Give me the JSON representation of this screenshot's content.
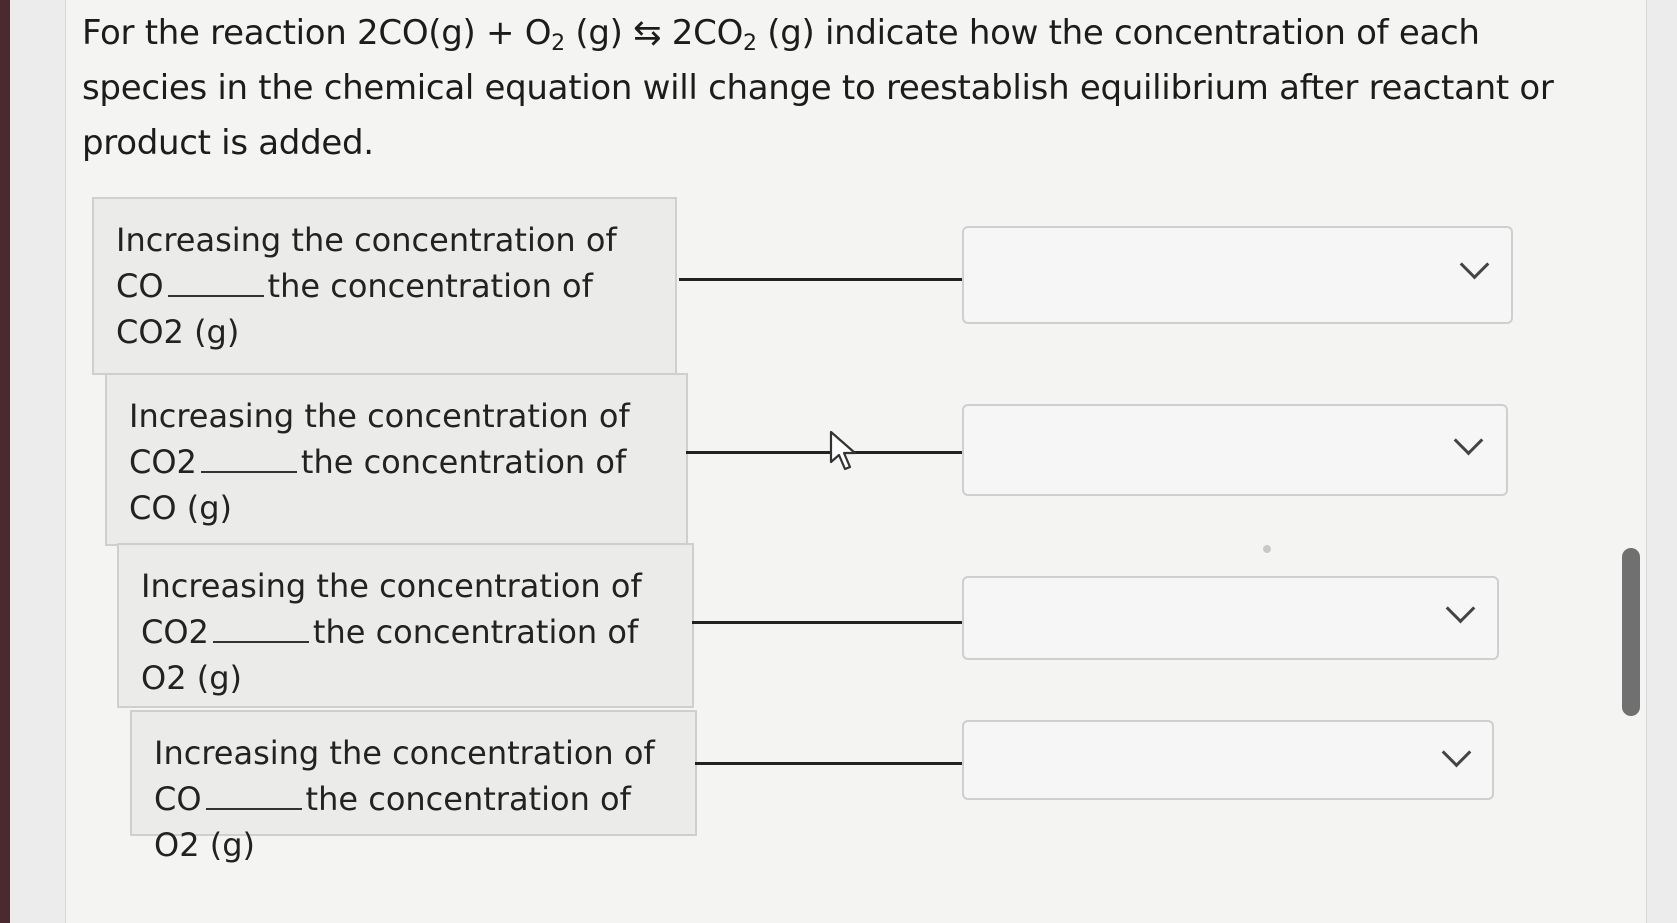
{
  "question": {
    "part1": "For the reaction 2CO(g) + O",
    "sub1": "2",
    "part2": " (g) ⇆ 2CO",
    "sub2": "2",
    "part3": " (g) indicate how the concentration of each species in the chemical equation will change to reestablish equilibrium after reactant or product is added."
  },
  "items": [
    {
      "pre": "Increasing the concentration of CO",
      "post": "the concentration of CO2 (g)",
      "selected": ""
    },
    {
      "pre": "Increasing the concentration of CO2",
      "post": "the concentration of CO (g)",
      "selected": ""
    },
    {
      "pre": "Increasing the concentration of CO2",
      "post": "the concentration of O2 (g)",
      "selected": ""
    },
    {
      "pre": "Increasing the concentration of CO",
      "post": "the concentration of O2 (g)",
      "selected": ""
    }
  ],
  "icons": {
    "dropdown": "chevron-down-icon",
    "cursor": "mouse-pointer-icon"
  },
  "colors": {
    "prompt_bg": "#ebebea",
    "panel_bg": "#f4f4f3",
    "scrollbar": "#707070"
  }
}
